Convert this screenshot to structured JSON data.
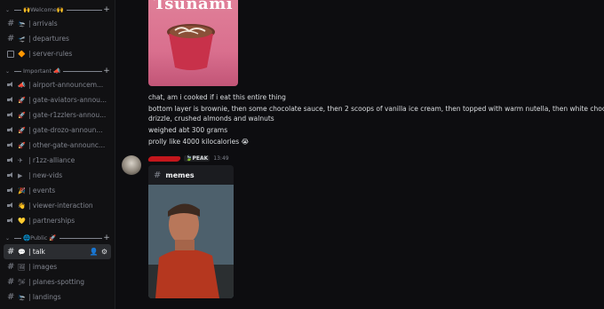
{
  "sidebar": {
    "categories": [
      {
        "label": "🙌Welcome🙌",
        "channels": [
          {
            "icon": "🛬",
            "name": "| arrivals",
            "type": "text"
          },
          {
            "icon": "🛫",
            "name": "| departures",
            "type": "text"
          },
          {
            "icon": "🔶",
            "name": "| server-rules",
            "type": "rules"
          }
        ]
      },
      {
        "label": "Important 📣",
        "channels": [
          {
            "icon": "📣",
            "name": "| airport-announcem...",
            "type": "announce"
          },
          {
            "icon": "🚀",
            "name": "| gate-aviators-annou...",
            "type": "announce"
          },
          {
            "icon": "🚀",
            "name": "| gate-r1zzlers-annou...",
            "type": "announce"
          },
          {
            "icon": "🚀",
            "name": "| gate-drozo-announ...",
            "type": "announce"
          },
          {
            "icon": "🚀",
            "name": "| other-gate-announc...",
            "type": "announce"
          },
          {
            "icon": "✈",
            "name": "| r1zz-alliance",
            "type": "announce"
          },
          {
            "icon": "▶",
            "name": "| new-vids",
            "type": "announce"
          },
          {
            "icon": "🎉",
            "name": "| events",
            "type": "announce"
          },
          {
            "icon": "👋",
            "name": "| viewer-interaction",
            "type": "announce"
          },
          {
            "icon": "💛",
            "name": "| partnerships",
            "type": "announce"
          }
        ]
      },
      {
        "label": "🌐Public 🚀",
        "channels": [
          {
            "icon": "💬",
            "name": "| talk",
            "type": "text",
            "active": true
          },
          {
            "icon": "🖼",
            "name": "| images",
            "type": "text"
          },
          {
            "icon": "🛩",
            "name": "| planes-spotting",
            "type": "text"
          },
          {
            "icon": "🛬",
            "name": "| landings",
            "type": "text"
          }
        ]
      }
    ]
  },
  "messages": {
    "image_caption": "Tsunami",
    "lines": [
      "chat, am i cooked if i eat this entire thing",
      "bottom layer is brownie, then some chocolate sauce, then 2 scoops of vanilla ice cream, then topped with warm nutella, then white chocolate",
      "drizzle, crushed almonds and walnuts",
      "weighed abt 300 grams",
      "prolly like 4000 kilocalories 😭"
    ],
    "second": {
      "tag": "PEAK",
      "time": "13:49",
      "embed_title": "memes"
    }
  }
}
